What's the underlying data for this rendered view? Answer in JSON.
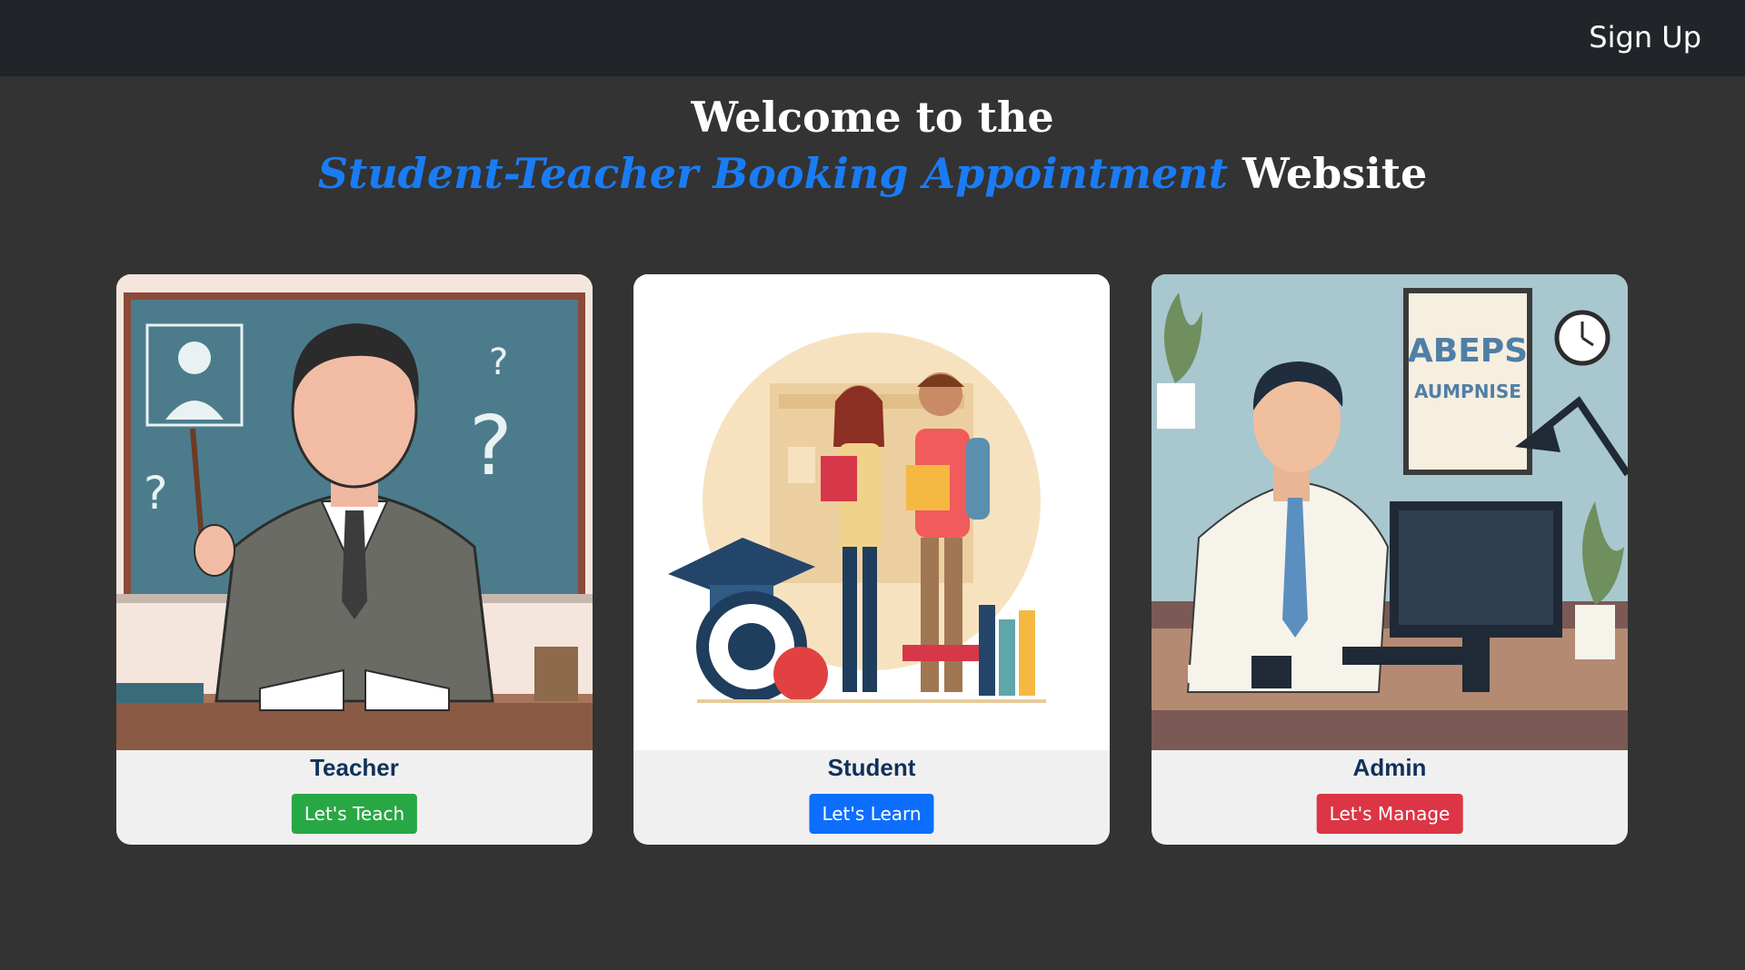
{
  "nav": {
    "signup_label": "Sign Up"
  },
  "hero": {
    "line1": "Welcome to the",
    "accent": "Student-Teacher Booking Appointment",
    "line2_rest": "Website",
    "accent_color": "#1a7cf5"
  },
  "cards": [
    {
      "title": "Teacher",
      "button_label": "Let's Teach",
      "button_color": "#28a745"
    },
    {
      "title": "Student",
      "button_label": "Let's Learn",
      "button_color": "#0d6efd"
    },
    {
      "title": "Admin",
      "button_label": "Let's Manage",
      "button_color": "#dc3545"
    }
  ],
  "admin_poster": {
    "line1": "ABEPS",
    "line2": "AUMPNISE"
  }
}
